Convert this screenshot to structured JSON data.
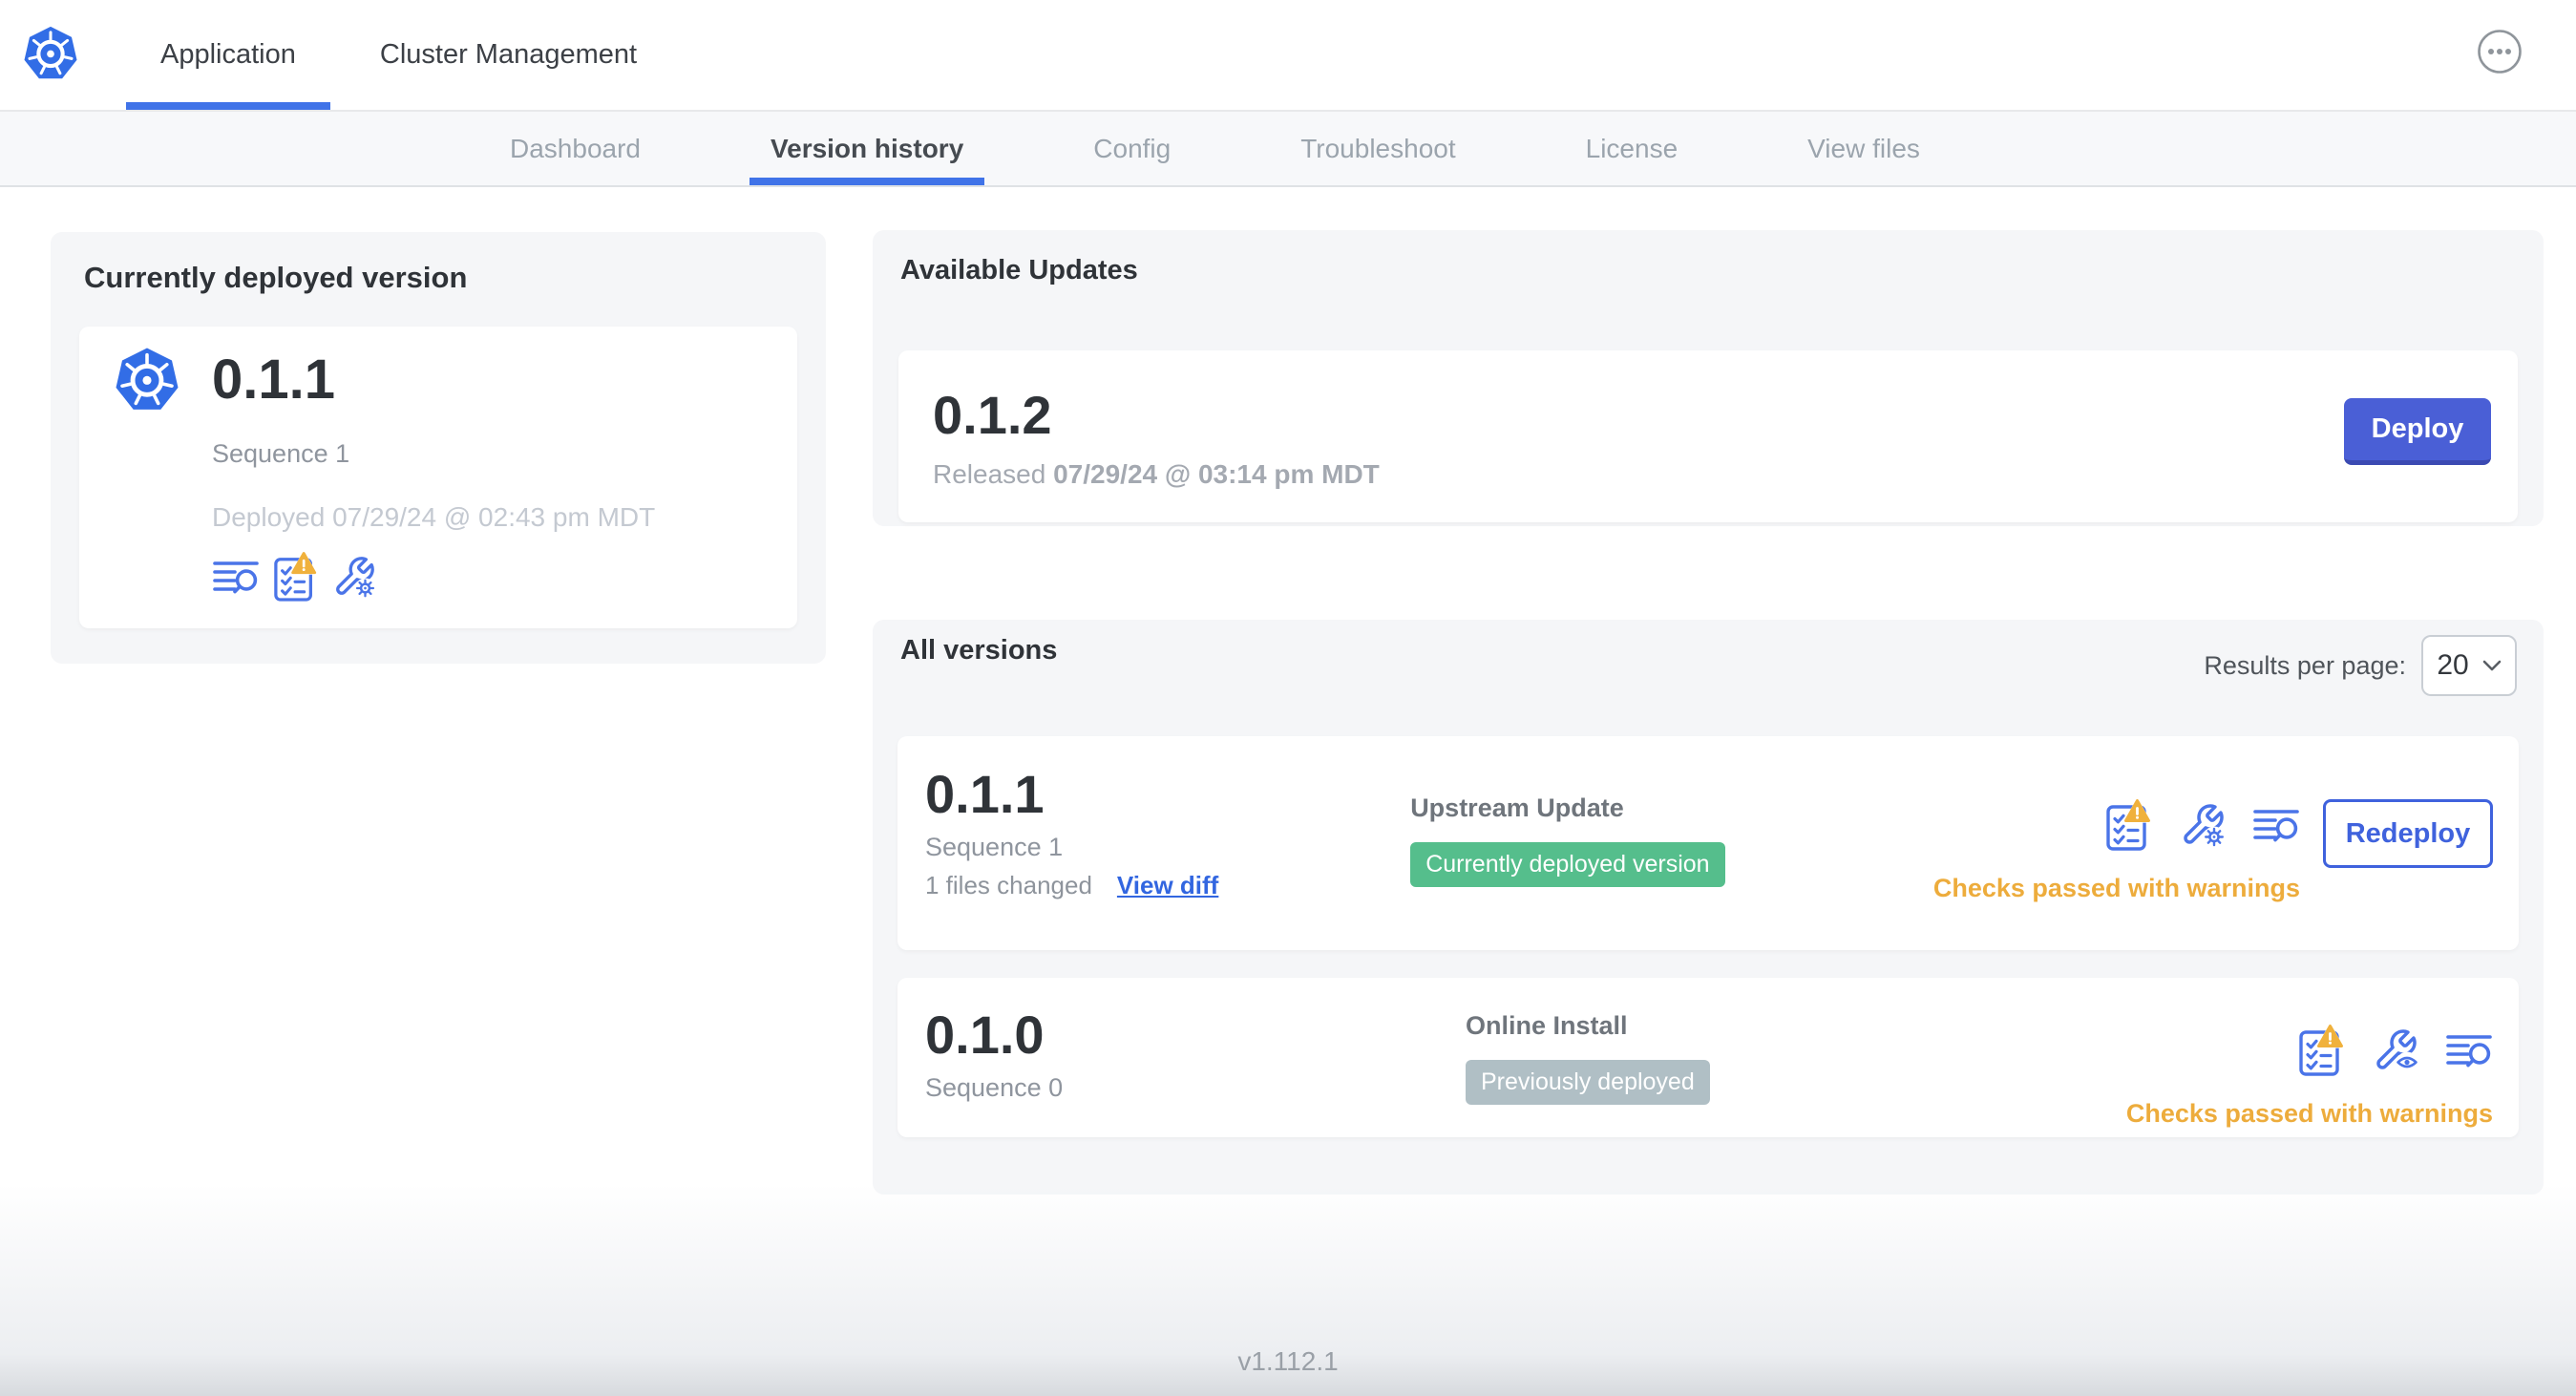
{
  "colors": {
    "accent_blue": "#4073e8",
    "icon_blue": "#4a74e8",
    "link_blue": "#3266e0",
    "deploy_button": "#4a5fd6",
    "deploy_button_shadow": "#3b4ab2",
    "redeploy_blue": "#3f62dd",
    "badge_green": "#55be8c",
    "badge_gray": "#b0bfc5",
    "warning_orange": "#edac3c",
    "warning_triangle": "#f0b13c",
    "k8s_logo_blue": "#326de6"
  },
  "header": {
    "tabs": [
      {
        "label": "Application"
      },
      {
        "label": "Cluster Management"
      }
    ],
    "more_icon": "ellipsis-circle-icon"
  },
  "subnav": {
    "items": [
      "Dashboard",
      "Version history",
      "Config",
      "Troubleshoot",
      "License",
      "View files"
    ]
  },
  "current_version": {
    "title": "Currently deployed version",
    "version": "0.1.1",
    "sequence": "Sequence 1",
    "deployed": "Deployed 07/29/24 @ 02:43 pm MDT",
    "icons": [
      "release-notes-icon",
      "preflight-checks-warning-icon",
      "edit-config-icon"
    ]
  },
  "available_updates": {
    "title": "Available Updates",
    "version": "0.1.2",
    "released_prefix": "Released",
    "released_date": "07/29/24 @ 03:14 pm MDT",
    "deploy_label": "Deploy"
  },
  "all_versions": {
    "title": "All versions",
    "results_per_page_label": "Results per page:",
    "results_per_page": "20",
    "rows": [
      {
        "version": "0.1.1",
        "sequence": "Sequence 1",
        "files_changed": "1 files changed",
        "view_diff_label": "View diff",
        "source": "Upstream Update",
        "badge": "Currently deployed version",
        "badge_type": "green",
        "action_label": "Redeploy",
        "status": "Checks passed with warnings",
        "icons": [
          "preflight-checks-warning-icon",
          "edit-config-icon",
          "release-notes-icon"
        ]
      },
      {
        "version": "0.1.0",
        "sequence": "Sequence 0",
        "source": "Online Install",
        "badge": "Previously deployed",
        "badge_type": "gray",
        "status": "Checks passed with warnings",
        "icons": [
          "preflight-checks-warning-icon",
          "view-config-icon",
          "release-notes-icon"
        ]
      }
    ]
  },
  "footer": {
    "app_version": "v1.112.1"
  }
}
